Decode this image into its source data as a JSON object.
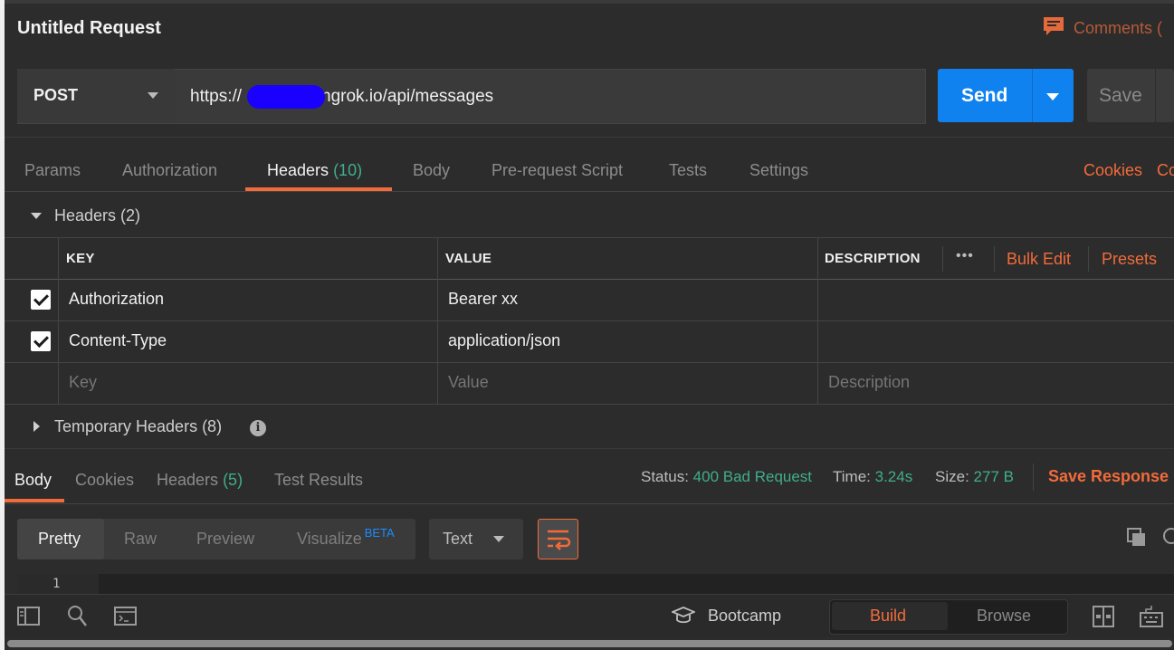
{
  "request": {
    "title": "Untitled Request",
    "comments_label": "Comments (",
    "method": "POST",
    "url_prefix": "https://",
    "url_suffix": "ngrok.io/api/messages",
    "send_label": "Send",
    "save_label": "Save"
  },
  "tabs": {
    "items": [
      "Params",
      "Authorization",
      "Headers",
      "Body",
      "Pre-request Script",
      "Tests",
      "Settings"
    ],
    "headers_count": "(10)",
    "active": "Headers",
    "cookies_link": "Cookies",
    "code_link_partial": "Co"
  },
  "headers_section": {
    "title": "Headers (2)",
    "columns": {
      "key": "KEY",
      "value": "VALUE",
      "description": "DESCRIPTION"
    },
    "more_label": "•••",
    "bulk_edit": "Bulk Edit",
    "presets": "Presets",
    "rows": [
      {
        "key": "Authorization",
        "value": "Bearer xx",
        "description": "",
        "checked": true
      },
      {
        "key": "Content-Type",
        "value": "application/json",
        "description": "",
        "checked": true
      }
    ],
    "placeholders": {
      "key": "Key",
      "value": "Value",
      "description": "Description"
    },
    "temporary": "Temporary Headers (8)"
  },
  "response": {
    "tabs": [
      "Body",
      "Cookies",
      "Headers",
      "Test Results"
    ],
    "headers_count": "(5)",
    "active": "Body",
    "status_label": "Status:",
    "status_value": "400 Bad Request",
    "time_label": "Time:",
    "time_value": "3.24s",
    "size_label": "Size:",
    "size_value": "277 B",
    "save_response": "Save Response",
    "view_modes": [
      "Pretty",
      "Raw",
      "Preview",
      "Visualize"
    ],
    "beta": "BETA",
    "format": "Text",
    "line_number": "1"
  },
  "footer": {
    "bootcamp": "Bootcamp",
    "build": "Build",
    "browse": "Browse"
  },
  "colors": {
    "accent": "#f26b3a",
    "send": "#1082f0",
    "success": "#3fae8c"
  }
}
